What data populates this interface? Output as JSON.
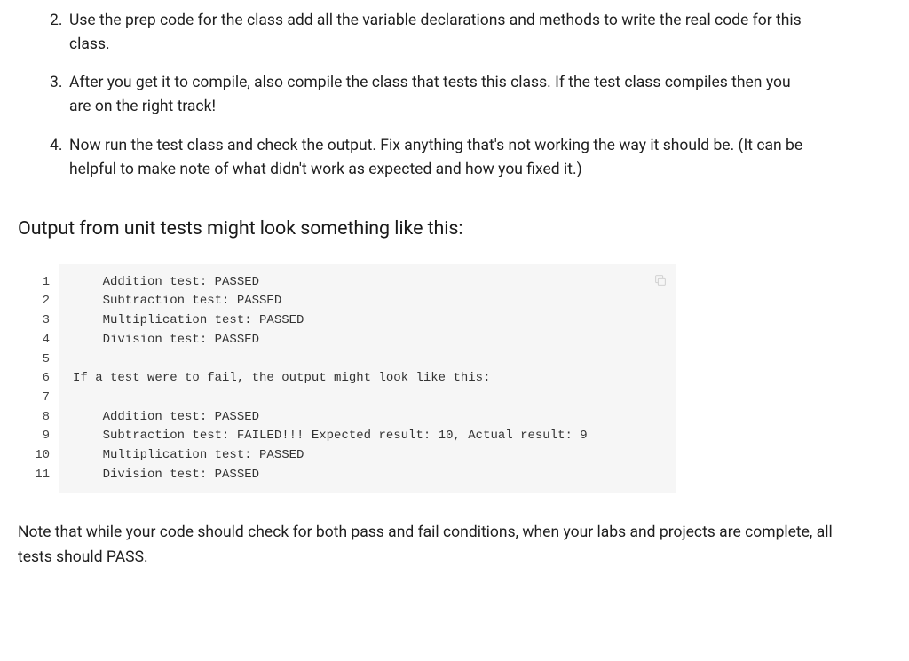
{
  "steps": [
    {
      "num": "2.",
      "text": "Use the prep code for the class add all the variable declarations and methods to write the real code for this class."
    },
    {
      "num": "3.",
      "text": "After you get it to compile, also compile the class that tests this class. If the test class compiles then you are on the right track!"
    },
    {
      "num": "4.",
      "text": "Now run the test class and check the output. Fix anything that's not working the way it should be. (It can be helpful to make note of what didn't work as expected and how you fixed it.)"
    }
  ],
  "section_heading": "Output from unit tests might look something like this:",
  "code": {
    "line_numbers": [
      "1",
      "2",
      "3",
      "4",
      "5",
      "6",
      "7",
      "8",
      "9",
      "10",
      "11"
    ],
    "lines": [
      "    Addition test: PASSED",
      "    Subtraction test: PASSED",
      "    Multiplication test: PASSED",
      "    Division test: PASSED",
      "",
      "If a test were to fail, the output might look like this:",
      "",
      "    Addition test: PASSED",
      "    Subtraction test: FAILED!!! Expected result: 10, Actual result: 9",
      "    Multiplication test: PASSED",
      "    Division test: PASSED"
    ]
  },
  "note": "Note that while your code should check for both pass and fail conditions, when your labs and projects are complete, all tests should PASS."
}
